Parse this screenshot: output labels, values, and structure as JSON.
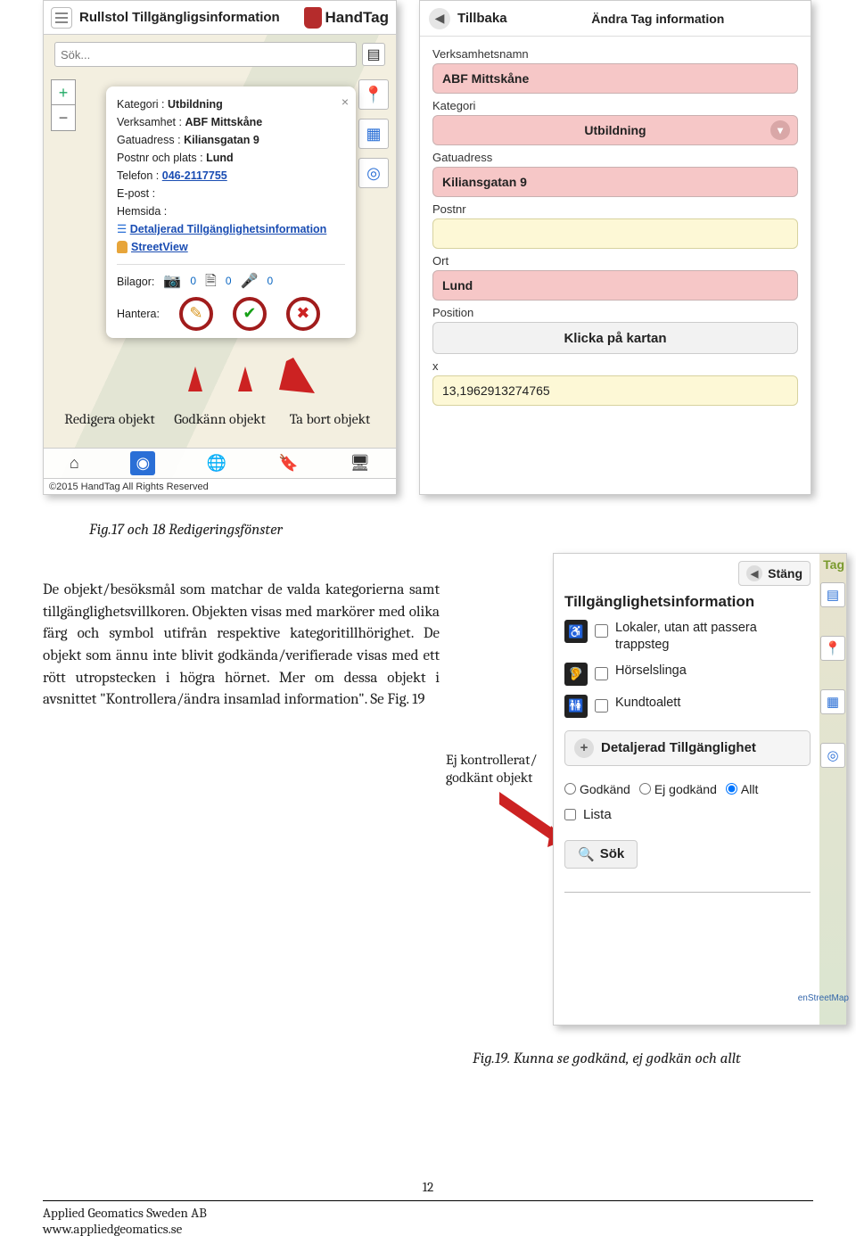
{
  "left": {
    "title": "Rullstol Tillgängligsinformation",
    "brand": "HandTag",
    "search_placeholder": "Sök...",
    "footer": "©2015 HandTag All Rights Reserved",
    "zoom_in": "+",
    "zoom_out": "−"
  },
  "popup": {
    "kategori_lbl": "Kategori :",
    "kategori": "Utbildning",
    "verk_lbl": "Verksamhet :",
    "verk": "ABF Mittskåne",
    "gata_lbl": "Gatuadress :",
    "gata": "Kiliansgatan 9",
    "post_lbl": "Postnr och plats :",
    "post": "Lund",
    "tel_lbl": "Telefon :",
    "tel": "046-2117755",
    "epost_lbl": "E-post :",
    "hemsida_lbl": "Hemsida :",
    "det_link": "Detaljerad Tillgänglighetsinformation",
    "sv_link": "StreetView",
    "bilagor_lbl": "Bilagor:",
    "cam_cnt": "0",
    "doc_cnt": "0",
    "mic_cnt": "0",
    "hantera_lbl": "Hantera:"
  },
  "callouts": {
    "edit": "Redigera objekt",
    "ok": "Godkänn objekt",
    "del": "Ta bort objekt"
  },
  "fig17": "Fig.17 och 18 Redigeringsfönster",
  "right": {
    "back": "Tillbaka",
    "title": "Ändra Tag information",
    "verk_lbl": "Verksamhetsnamn",
    "verk": "ABF Mittskåne",
    "kat_lbl": "Kategori",
    "kat": "Utbildning",
    "gata_lbl": "Gatuadress",
    "gata": "Kiliansgatan 9",
    "postnr_lbl": "Postnr",
    "ort_lbl": "Ort",
    "ort": "Lund",
    "pos_lbl": "Position",
    "pos_btn": "Klicka på kartan",
    "x_lbl": "x",
    "x_val": "13,1962913274765"
  },
  "body": "De objekt/besöksmål som matchar de valda kategorierna samt tillgänglighetsvillkoren. Objekten visas med markörer med olika färg och symbol utifrån respektive kategoritillhörighet. De objekt som ännu inte blivit godkända/verifierade visas med ett rött utropstecken i högra hörnet. Mer om dessa objekt i avsnittet \"Kontrollera/ändra insamlad information\". Se Fig. 19",
  "ej": {
    "l1": "Ej kontrollerat/",
    "l2": "godkänt objekt"
  },
  "filter": {
    "tag": "Tag",
    "stang": "Stäng",
    "heading": "Tillgänglighetsinformation",
    "opt1": "Lokaler, utan att passera trappsteg",
    "opt2": "Hörselslinga",
    "opt3": "Kundtoalett",
    "det_btn": "Detaljerad Tillgänglighet",
    "r1": "Godkänd",
    "r2": "Ej godkänd",
    "r3": "Allt",
    "lista": "Lista",
    "sok": "Sök",
    "osm": "enStreetMap"
  },
  "fig19": "Fig.19.  Kunna se godkänd, ej godkän och allt",
  "footer": {
    "org": "Applied Geomatics Sweden AB",
    "url": "www.appliedgeomatics.se",
    "page": "12"
  }
}
